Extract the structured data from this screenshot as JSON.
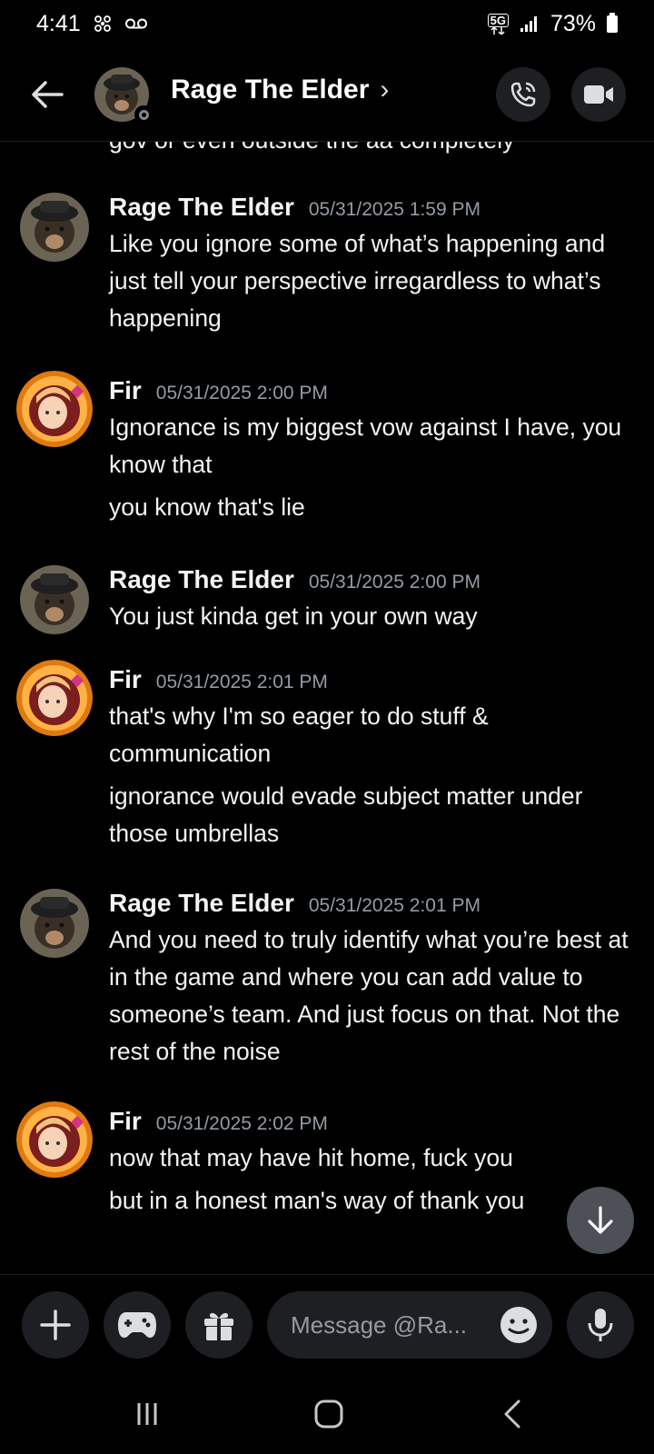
{
  "status_bar": {
    "time": "4:41",
    "network": "5G",
    "battery": "73%"
  },
  "header": {
    "title": "Rage The Elder",
    "chevron": "›",
    "back_icon": "arrow-left-icon",
    "call_icon": "phone-icon",
    "video_icon": "video-camera-icon"
  },
  "messages": {
    "partial_top_line": "gov or even outside the aa completely",
    "groups": [
      {
        "author": "Rage The Elder",
        "timestamp": "05/31/2025 1:59 PM",
        "lines": [
          "Like you ignore some of what’s happening and just tell your perspective irregardless to what’s happening"
        ]
      },
      {
        "author": "Fir",
        "timestamp": "05/31/2025 2:00 PM",
        "lines": [
          "Ignorance is my biggest vow against I have, you know that",
          "you know that's lie"
        ]
      },
      {
        "author": "Rage The Elder",
        "timestamp": "05/31/2025 2:00 PM",
        "lines": [
          "You just kinda get in your own way"
        ]
      },
      {
        "author": "Fir",
        "timestamp": "05/31/2025 2:01 PM",
        "lines": [
          "that's why I'm so eager to do stuff & communication",
          "ignorance would evade subject matter under those umbrellas"
        ]
      },
      {
        "author": "Rage The Elder",
        "timestamp": "05/31/2025 2:01 PM",
        "lines": [
          "And you need to truly identify what you’re best at in the game and where you can add value to someone’s team. And just focus on that. Not the rest of the noise"
        ]
      },
      {
        "author": "Fir",
        "timestamp": "05/31/2025 2:02 PM",
        "lines": [
          "now that may have hit home, fuck you",
          "but in a honest man's way of thank you"
        ]
      }
    ]
  },
  "composer": {
    "placeholder": "Message @Ra...",
    "plus_icon": "plus-icon",
    "game_icon": "gamepad-icon",
    "gift_icon": "gift-icon",
    "emoji_icon": "emoji-icon",
    "mic_icon": "microphone-icon"
  },
  "colors": {
    "background": "#000000",
    "surface": "#1e1f22",
    "text_primary": "#f2f3f5",
    "text_muted": "#949ba4",
    "jump_button": "#4e5058"
  }
}
